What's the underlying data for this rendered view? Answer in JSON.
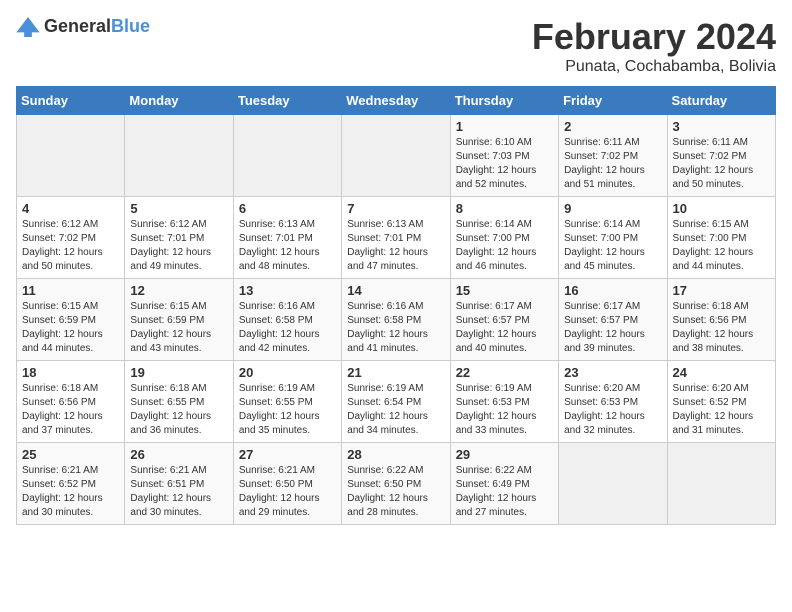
{
  "header": {
    "logo_general": "General",
    "logo_blue": "Blue",
    "title": "February 2024",
    "subtitle": "Punata, Cochabamba, Bolivia"
  },
  "calendar": {
    "days_of_week": [
      "Sunday",
      "Monday",
      "Tuesday",
      "Wednesday",
      "Thursday",
      "Friday",
      "Saturday"
    ],
    "weeks": [
      [
        {
          "day": "",
          "info": ""
        },
        {
          "day": "",
          "info": ""
        },
        {
          "day": "",
          "info": ""
        },
        {
          "day": "",
          "info": ""
        },
        {
          "day": "1",
          "info": "Sunrise: 6:10 AM\nSunset: 7:03 PM\nDaylight: 12 hours and 52 minutes."
        },
        {
          "day": "2",
          "info": "Sunrise: 6:11 AM\nSunset: 7:02 PM\nDaylight: 12 hours and 51 minutes."
        },
        {
          "day": "3",
          "info": "Sunrise: 6:11 AM\nSunset: 7:02 PM\nDaylight: 12 hours and 50 minutes."
        }
      ],
      [
        {
          "day": "4",
          "info": "Sunrise: 6:12 AM\nSunset: 7:02 PM\nDaylight: 12 hours and 50 minutes."
        },
        {
          "day": "5",
          "info": "Sunrise: 6:12 AM\nSunset: 7:01 PM\nDaylight: 12 hours and 49 minutes."
        },
        {
          "day": "6",
          "info": "Sunrise: 6:13 AM\nSunset: 7:01 PM\nDaylight: 12 hours and 48 minutes."
        },
        {
          "day": "7",
          "info": "Sunrise: 6:13 AM\nSunset: 7:01 PM\nDaylight: 12 hours and 47 minutes."
        },
        {
          "day": "8",
          "info": "Sunrise: 6:14 AM\nSunset: 7:00 PM\nDaylight: 12 hours and 46 minutes."
        },
        {
          "day": "9",
          "info": "Sunrise: 6:14 AM\nSunset: 7:00 PM\nDaylight: 12 hours and 45 minutes."
        },
        {
          "day": "10",
          "info": "Sunrise: 6:15 AM\nSunset: 7:00 PM\nDaylight: 12 hours and 44 minutes."
        }
      ],
      [
        {
          "day": "11",
          "info": "Sunrise: 6:15 AM\nSunset: 6:59 PM\nDaylight: 12 hours and 44 minutes."
        },
        {
          "day": "12",
          "info": "Sunrise: 6:15 AM\nSunset: 6:59 PM\nDaylight: 12 hours and 43 minutes."
        },
        {
          "day": "13",
          "info": "Sunrise: 6:16 AM\nSunset: 6:58 PM\nDaylight: 12 hours and 42 minutes."
        },
        {
          "day": "14",
          "info": "Sunrise: 6:16 AM\nSunset: 6:58 PM\nDaylight: 12 hours and 41 minutes."
        },
        {
          "day": "15",
          "info": "Sunrise: 6:17 AM\nSunset: 6:57 PM\nDaylight: 12 hours and 40 minutes."
        },
        {
          "day": "16",
          "info": "Sunrise: 6:17 AM\nSunset: 6:57 PM\nDaylight: 12 hours and 39 minutes."
        },
        {
          "day": "17",
          "info": "Sunrise: 6:18 AM\nSunset: 6:56 PM\nDaylight: 12 hours and 38 minutes."
        }
      ],
      [
        {
          "day": "18",
          "info": "Sunrise: 6:18 AM\nSunset: 6:56 PM\nDaylight: 12 hours and 37 minutes."
        },
        {
          "day": "19",
          "info": "Sunrise: 6:18 AM\nSunset: 6:55 PM\nDaylight: 12 hours and 36 minutes."
        },
        {
          "day": "20",
          "info": "Sunrise: 6:19 AM\nSunset: 6:55 PM\nDaylight: 12 hours and 35 minutes."
        },
        {
          "day": "21",
          "info": "Sunrise: 6:19 AM\nSunset: 6:54 PM\nDaylight: 12 hours and 34 minutes."
        },
        {
          "day": "22",
          "info": "Sunrise: 6:19 AM\nSunset: 6:53 PM\nDaylight: 12 hours and 33 minutes."
        },
        {
          "day": "23",
          "info": "Sunrise: 6:20 AM\nSunset: 6:53 PM\nDaylight: 12 hours and 32 minutes."
        },
        {
          "day": "24",
          "info": "Sunrise: 6:20 AM\nSunset: 6:52 PM\nDaylight: 12 hours and 31 minutes."
        }
      ],
      [
        {
          "day": "25",
          "info": "Sunrise: 6:21 AM\nSunset: 6:52 PM\nDaylight: 12 hours and 30 minutes."
        },
        {
          "day": "26",
          "info": "Sunrise: 6:21 AM\nSunset: 6:51 PM\nDaylight: 12 hours and 30 minutes."
        },
        {
          "day": "27",
          "info": "Sunrise: 6:21 AM\nSunset: 6:50 PM\nDaylight: 12 hours and 29 minutes."
        },
        {
          "day": "28",
          "info": "Sunrise: 6:22 AM\nSunset: 6:50 PM\nDaylight: 12 hours and 28 minutes."
        },
        {
          "day": "29",
          "info": "Sunrise: 6:22 AM\nSunset: 6:49 PM\nDaylight: 12 hours and 27 minutes."
        },
        {
          "day": "",
          "info": ""
        },
        {
          "day": "",
          "info": ""
        }
      ]
    ]
  }
}
